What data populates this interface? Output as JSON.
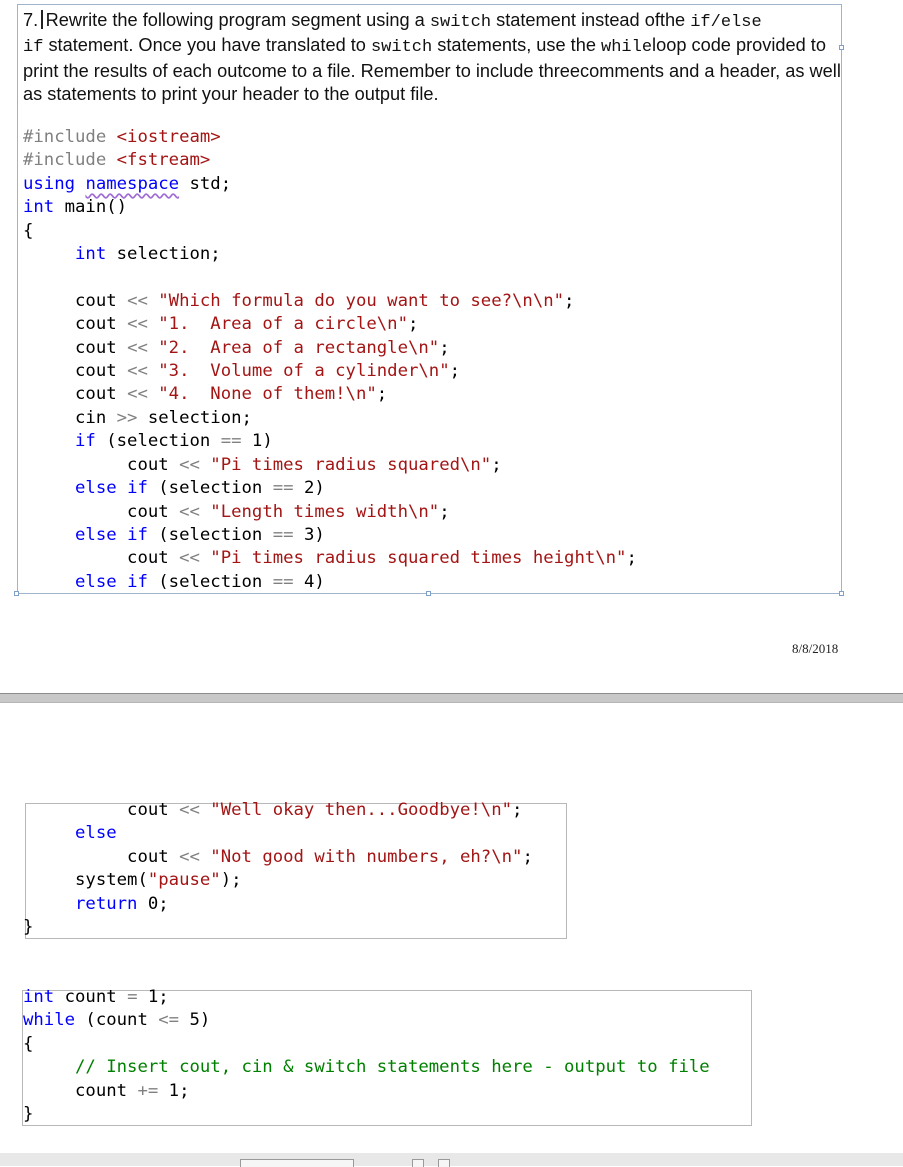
{
  "question": {
    "number": "7.",
    "text_1": "Rewrite the following program segment using a ",
    "kw_switch": "switch",
    "text_2": " statement instead ofthe ",
    "kw_ifelse": "if/else",
    "kw_if": "if",
    "text_3": " statement. Once you have translated to ",
    "kw_switch2": "switch",
    "text_4": " statements, use the ",
    "kw_while": "while",
    "text_5": "loop code provided to print the results of each outcome to a file. Remember to include threecomments and a header, as well as statements to print your header to the output file."
  },
  "code_block_1": {
    "line1_a": "#include ",
    "line1_b": "<iostream>",
    "line2_a": "#include ",
    "line2_b": "<fstream>",
    "line3_a": "using",
    "line3_b": "namespace",
    "line3_c": " std;",
    "line4_a": "int",
    "line4_b": " main()",
    "line5": "{",
    "line6_a": "int",
    "line6_b": " selection;",
    "cout": "cout ",
    "shl": "<<",
    "shr": ">>",
    "str1": "\"Which formula do you want to see?\\n\\n\"",
    "str2": "\"1.  Area of a circle\\n\"",
    "str3": "\"2.  Area of a rectangle\\n\"",
    "str4": "\"3.  Volume of a cylinder\\n\"",
    "str5": "\"4.  None of them!\\n\"",
    "semi": ";",
    "cin": "cin ",
    "cin_rest": " selection;",
    "if": "if",
    "else": "else",
    "cond1": " (selection ",
    "eq": "==",
    "v1": " 1)",
    "v2": " 2)",
    "v3": " 3)",
    "v4": " 4)",
    "s_pi": "\"Pi times radius squared\\n\"",
    "s_len": "\"Length times width\\n\"",
    "s_vol": "\"Pi times radius squared times height\\n\""
  },
  "footer": {
    "date": "8/8/2018"
  },
  "code_block_2": {
    "s_bye": "\"Well okay then...Goodbye!\\n\"",
    "else": "else",
    "s_num": "\"Not good with numbers, eh?\\n\"",
    "sys_a": "system(",
    "sys_b": "\"pause\"",
    "sys_c": ");",
    "ret_a": "return",
    "ret_b": " 0;",
    "close": "}"
  },
  "code_block_3": {
    "l1_a": "int",
    "l1_b": " count ",
    "l1_c": "=",
    "l1_d": " 1;",
    "l2_a": "while",
    "l2_b": " (count ",
    "l2_c": "<=",
    "l2_d": " 5)",
    "l3": "{",
    "l4": "// Insert cout, cin & switch statements here - output to file",
    "l5_a": "count ",
    "l5_b": "+=",
    "l5_c": " 1;",
    "l6": "}"
  },
  "colors": {
    "keyword": "#0000ff",
    "string": "#a31515",
    "comment": "#008000",
    "preprocessor": "#808080"
  }
}
